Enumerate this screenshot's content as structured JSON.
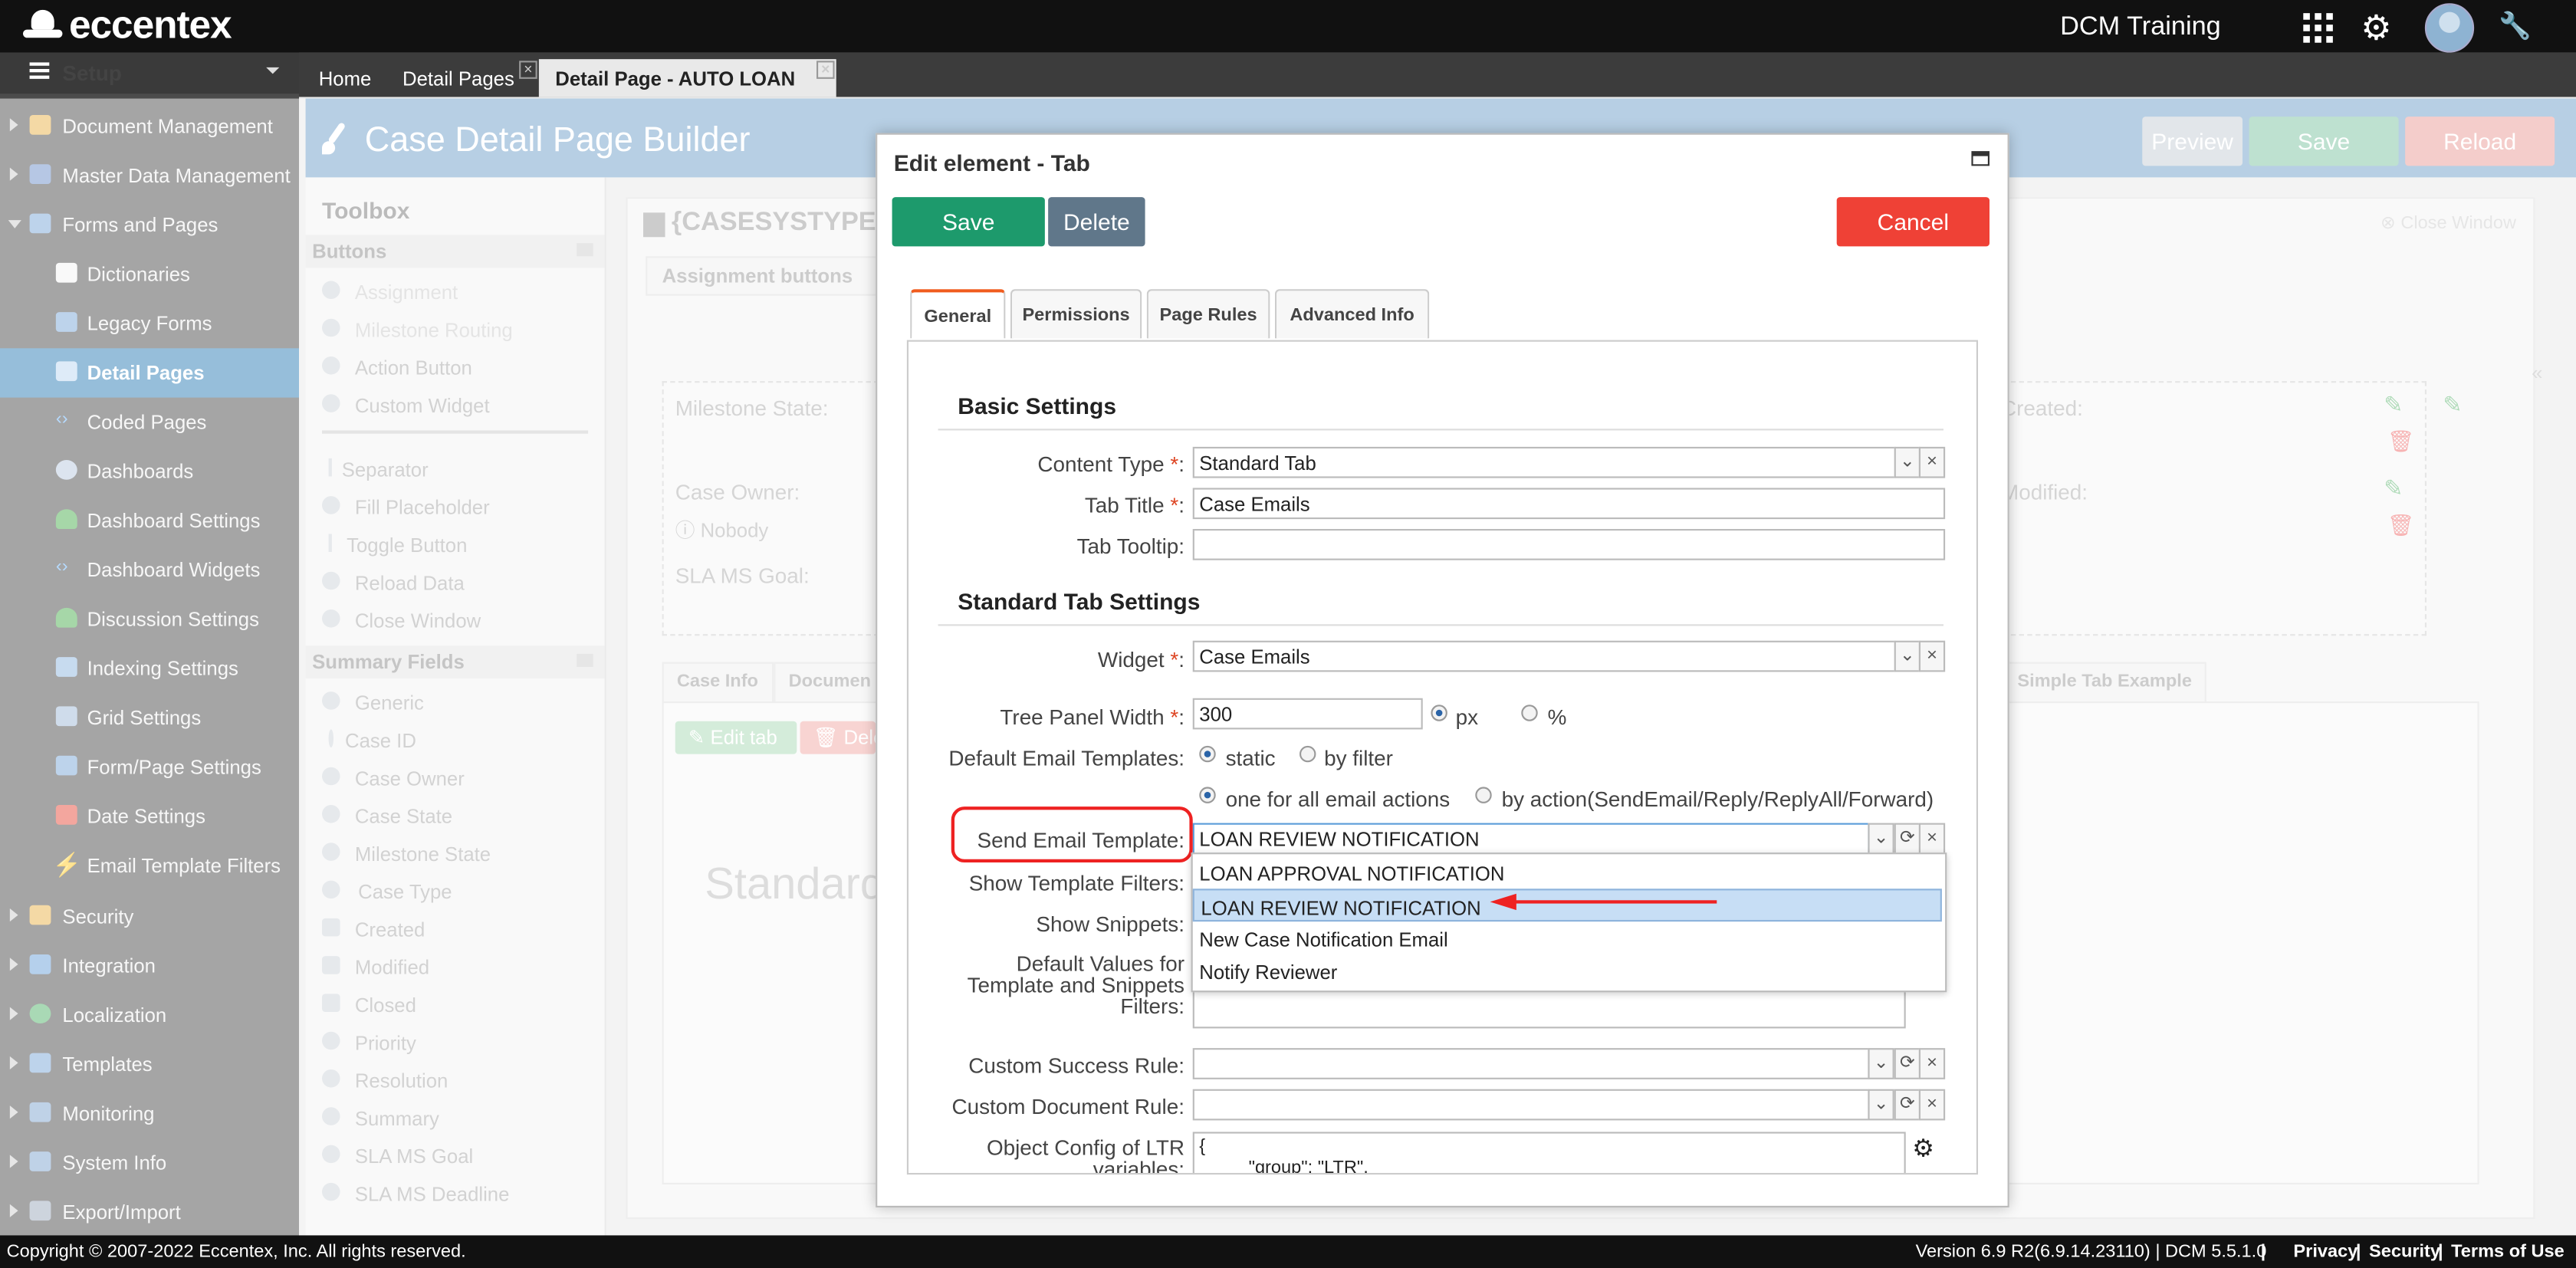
{
  "topbar": {
    "logo": "eccentex",
    "env": "DCM Training"
  },
  "sidebar": {
    "header": "Setup",
    "items": [
      {
        "label": "Document Management"
      },
      {
        "label": "Master Data Management"
      },
      {
        "label": "Forms and Pages"
      },
      {
        "label": "Dictionaries"
      },
      {
        "label": "Legacy Forms"
      },
      {
        "label": "Detail Pages"
      },
      {
        "label": "Coded Pages"
      },
      {
        "label": "Dashboards"
      },
      {
        "label": "Dashboard Settings"
      },
      {
        "label": "Dashboard Widgets"
      },
      {
        "label": "Discussion Settings"
      },
      {
        "label": "Indexing Settings"
      },
      {
        "label": "Grid Settings"
      },
      {
        "label": "Form/Page Settings"
      },
      {
        "label": "Date Settings"
      },
      {
        "label": "Email Template Filters"
      },
      {
        "label": "Security"
      },
      {
        "label": "Integration"
      },
      {
        "label": "Localization"
      },
      {
        "label": "Templates"
      },
      {
        "label": "Monitoring"
      },
      {
        "label": "System Info"
      },
      {
        "label": "Export/Import"
      }
    ]
  },
  "tabs": [
    {
      "label": "Home"
    },
    {
      "label": "Detail Pages"
    },
    {
      "label": "Detail Page - AUTO LOAN"
    }
  ],
  "builder": {
    "title": "Case Detail Page Builder",
    "preview": "Preview",
    "save": "Save",
    "reload": "Reload"
  },
  "toolbox": {
    "title": "Toolbox",
    "buttons_section": "Buttons",
    "buttons": [
      "Assignment",
      "Milestone Routing",
      "Action Button",
      "Custom Widget",
      "Separator",
      "Fill Placeholder",
      "Toggle Button",
      "Reload Data",
      "Close Window"
    ],
    "summary_section": "Summary Fields",
    "summary": [
      "Generic",
      "Case ID",
      "Case Owner",
      "Case State",
      "Milestone State",
      "Case Type",
      "Created",
      "Modified",
      "Closed",
      "Priority",
      "Resolution",
      "Summary",
      "SLA MS Goal",
      "SLA MS Deadline"
    ]
  },
  "canvas": {
    "casesystype": "{CASESYSTYPE",
    "assignment_buttons": "Assignment buttons",
    "close_window": "Close Window",
    "milestone_state": "Milestone State:",
    "case_owner": "Case Owner:",
    "nobody": "Nobody",
    "sla_ms_goal": "SLA MS Goal:",
    "created": "Created:",
    "modified": "Modified:",
    "tab_case_info": "Case Info",
    "tab_documents": "Documen",
    "tab_simple": "Simple Tab Example",
    "edit_tab": "Edit tab",
    "delete_tab": "Dele",
    "standard": "Standard"
  },
  "modal": {
    "title": "Edit element - Tab",
    "save": "Save",
    "delete": "Delete",
    "cancel": "Cancel",
    "tabs": [
      "General",
      "Permissions",
      "Page Rules",
      "Advanced Info"
    ],
    "basic_settings": "Basic Settings",
    "content_type_label": "Content Type",
    "content_type_value": "Standard Tab",
    "tab_title_label": "Tab Title",
    "tab_title_value": "Case Emails",
    "tab_tooltip_label": "Tab Tooltip:",
    "standard_tab_settings": "Standard Tab Settings",
    "widget_label": "Widget",
    "widget_value": "Case Emails",
    "tree_panel_label": "Tree Panel Width",
    "tree_panel_value": "300",
    "unit_px": "px",
    "unit_pct": "%",
    "default_email_label": "Default Email Templates:",
    "opt_static": "static",
    "opt_by_filter": "by filter",
    "opt_one_for_all": "one for all email actions",
    "opt_by_action": "by action(SendEmail/Reply/ReplyAll/Forward)",
    "send_email_label": "Send Email Template:",
    "send_email_value": "LOAN REVIEW NOTIFICATION",
    "show_template_filters": "Show Template Filters:",
    "show_snippets": "Show Snippets:",
    "default_values_l1": "Default Values for",
    "default_values_l2": "Template and Snippets",
    "default_values_l3": "Filters:",
    "custom_success_rule": "Custom Success Rule:",
    "custom_document_rule": "Custom Document Rule:",
    "object_config_l1": "Object Config of LTR",
    "object_config_l2": "variables:",
    "object_config_code_1": "{",
    "object_config_code_2": "\"group\": \"LTR\",",
    "dropdown_options": [
      "LOAN APPROVAL NOTIFICATION",
      "LOAN REVIEW NOTIFICATION",
      "New Case Notification Email",
      "Notify Reviewer"
    ]
  },
  "footer": {
    "copyright": "Copyright © 2007-2022 Eccentex, Inc. All rights reserved.",
    "version": "Version   6.9 R2(6.9.14.23110) | DCM 5.5.1.0",
    "privacy": "Privacy",
    "security": "Security",
    "terms": "Terms of Use",
    "sep": "|"
  },
  "colors": {
    "accent_blue": "#2c7db4",
    "save_green": "#1d9a6c",
    "cancel_red": "#ef4136",
    "highlight_red": "#e22222"
  }
}
